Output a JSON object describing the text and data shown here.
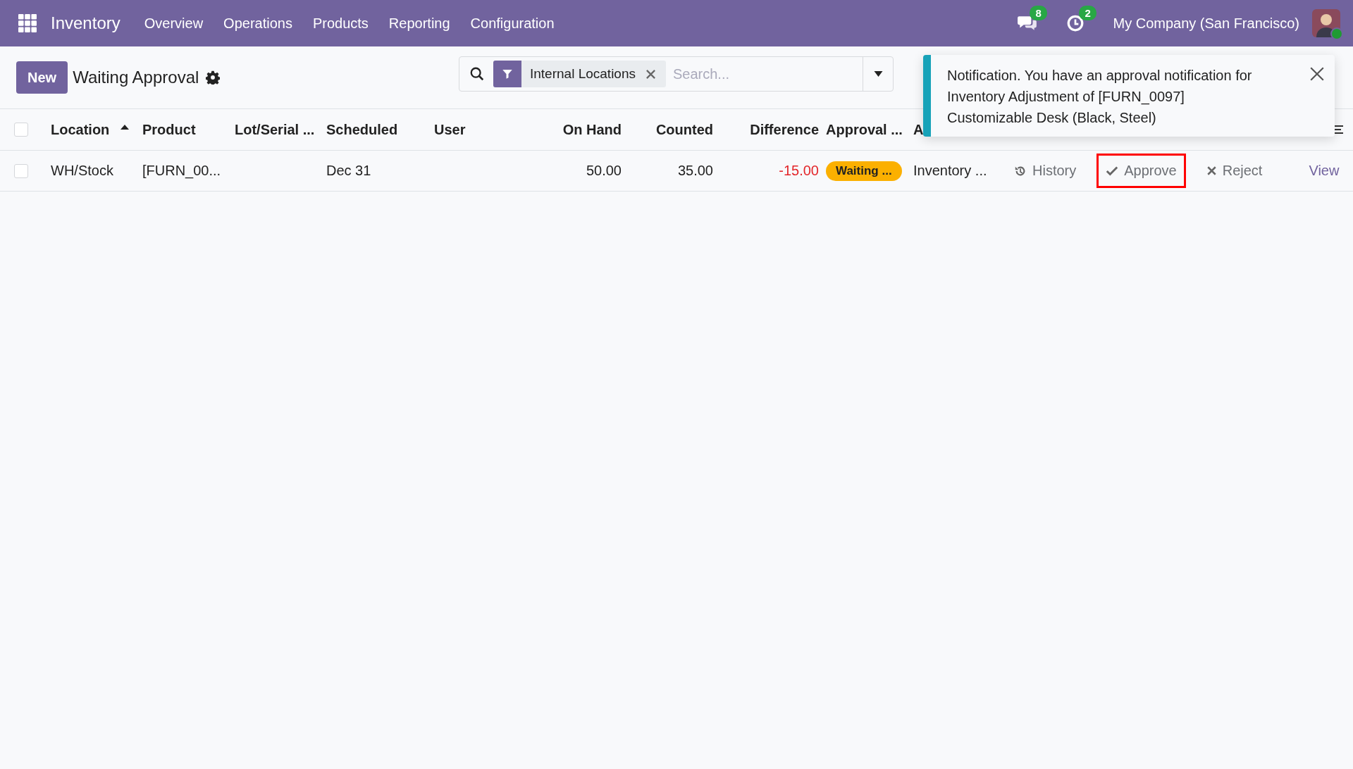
{
  "topbar": {
    "app": "Inventory",
    "menu": [
      "Overview",
      "Operations",
      "Products",
      "Reporting",
      "Configuration"
    ],
    "messages_count": "8",
    "activities_count": "2",
    "company": "My Company (San Francisco)",
    "user_online": true
  },
  "control_panel": {
    "new_button": "New",
    "title": "Waiting Approval",
    "facet": "Internal Locations",
    "search": {
      "placeholder": "Search..."
    }
  },
  "table": {
    "header_checked": false,
    "columns": [
      {
        "label": "Location",
        "sorted": true
      },
      {
        "label": "Product",
        "sorted": false
      },
      {
        "label": "Lot/Serial ...",
        "sorted": false
      },
      {
        "label": "Scheduled",
        "sorted": false
      },
      {
        "label": "User",
        "sorted": false
      },
      {
        "label": "On Hand",
        "sorted": false
      },
      {
        "label": "Counted",
        "sorted": false
      },
      {
        "label": "Difference",
        "sorted": false
      },
      {
        "label": "Approval ...",
        "sorted": false
      },
      {
        "label": "A",
        "sorted": false
      }
    ],
    "rows": [
      {
        "checked": false,
        "cells": [
          {
            "kind": "text",
            "text": "WH/Stock"
          },
          {
            "kind": "text",
            "text": "[FURN_00..."
          },
          {
            "kind": "blank"
          },
          {
            "kind": "text",
            "text": "Dec 31"
          },
          {
            "kind": "blank"
          },
          {
            "kind": "number",
            "text": "50.00"
          },
          {
            "kind": "number",
            "text": "35.00"
          },
          {
            "kind": "negative",
            "text": "-15.00"
          },
          {
            "kind": "badge",
            "text": "Waiting ..."
          },
          {
            "kind": "text",
            "text": "Inventory ..."
          }
        ],
        "actions": [
          {
            "kind": "history",
            "label": "History",
            "highlighted": false
          },
          {
            "kind": "approve",
            "label": "Approve",
            "highlighted": true
          },
          {
            "kind": "reject",
            "label": "Reject",
            "highlighted": false
          },
          {
            "kind": "link",
            "label": "View",
            "highlighted": false
          }
        ]
      }
    ]
  },
  "notification": {
    "text": "Notification. You have an approval notification for Inventory Adjustment of [FURN_0097] Customizable Desk (Black, Steel)"
  }
}
